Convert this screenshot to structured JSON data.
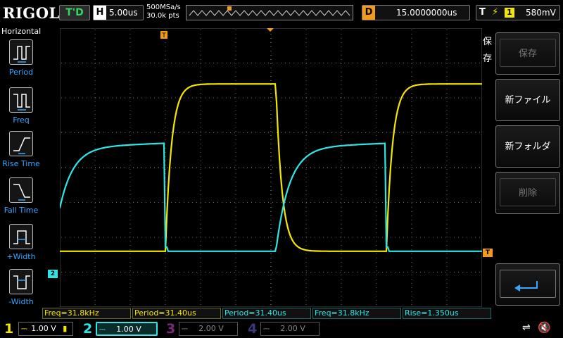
{
  "top": {
    "logo": "RIGOL",
    "trigger_state": "T'D",
    "horizontal_label": "H",
    "timebase": "5.00us",
    "sample_rate": "500MSa/s",
    "memory_depth": "30.0k pts",
    "delay_label": "D",
    "delay": "15.0000000us",
    "trigger_label": "T",
    "trigger_source": "1",
    "trigger_level": "580mV"
  },
  "left_menu": {
    "title": "Horizontal",
    "items": [
      {
        "label": "Period",
        "icon": "period-icon"
      },
      {
        "label": "Freq",
        "icon": "freq-icon"
      },
      {
        "label": "Rise Time",
        "icon": "rise-time-icon"
      },
      {
        "label": "Fall Time",
        "icon": "fall-time-icon"
      },
      {
        "label": "+Width",
        "icon": "plus-width-icon"
      },
      {
        "label": "-Width",
        "icon": "minus-width-icon"
      }
    ]
  },
  "right_menu": {
    "title": "保存",
    "items": [
      {
        "label": "保存",
        "enabled": false
      },
      {
        "label": "新ファイル",
        "enabled": true
      },
      {
        "label": "新フォルダ",
        "enabled": true
      },
      {
        "label": "削除",
        "enabled": false
      },
      {
        "label": "",
        "icon": "enter-return-icon",
        "enabled": true
      }
    ]
  },
  "measurements": [
    "Freq=31.8kHz",
    "Period=31.40us",
    "Period=31.40us",
    "Freq=31.8kHz",
    "Rise=1.350us"
  ],
  "channels": [
    {
      "num": "1",
      "scale": "1.00 V",
      "color": "#f3e600",
      "active": true
    },
    {
      "num": "2",
      "scale": "1.00 V",
      "color": "#2fe6e6",
      "active": true
    },
    {
      "num": "3",
      "scale": "2.00 V",
      "color": "#7a2a7a",
      "active": false
    },
    {
      "num": "4",
      "scale": "2.00 V",
      "color": "#3a3a7a",
      "active": false
    }
  ],
  "markers": {
    "trigger_marker": "T",
    "ch2_marker": "2"
  },
  "waveforms": {
    "timebase_us_per_div": 5.0,
    "volts_per_div": 1.0,
    "ch1": {
      "low_div": -2.4,
      "high_div": 2.4,
      "shape": "rc-square",
      "color": "#f3e600"
    },
    "ch2": {
      "low_div": -2.4,
      "high_div": 0.6,
      "shape": "rc-square-inverted",
      "color": "#2fe6e6"
    }
  }
}
